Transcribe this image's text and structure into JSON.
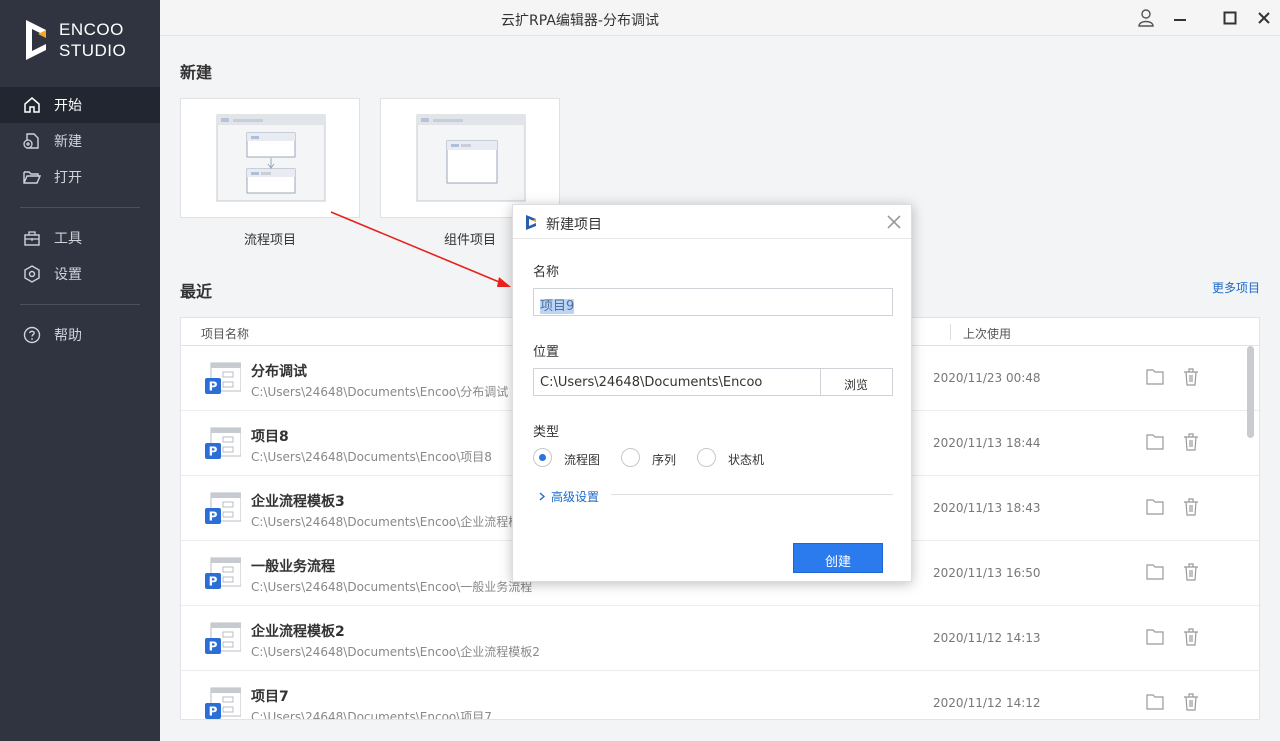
{
  "window": {
    "title": "云扩RPA编辑器-分布调试"
  },
  "brand": {
    "line1": "ENCOO",
    "line2": "STUDIO"
  },
  "colors": {
    "sidebar": "#2f3440",
    "accent": "#2b7bef",
    "link": "#1b6ac9",
    "arrow": "#e8211c"
  },
  "sidebar": {
    "items": [
      {
        "label": "开始",
        "icon": "home-icon",
        "active": true
      },
      {
        "label": "新建",
        "icon": "new-file-icon"
      },
      {
        "label": "打开",
        "icon": "folder-open-icon"
      },
      {
        "label": "工具",
        "icon": "toolbox-icon"
      },
      {
        "label": "设置",
        "icon": "gear-icon"
      },
      {
        "label": "帮助",
        "icon": "help-icon"
      }
    ]
  },
  "new_section": {
    "title": "新建",
    "cards": [
      {
        "label": "流程项目"
      },
      {
        "label": "组件项目"
      }
    ]
  },
  "recent": {
    "title": "最近",
    "more_label": "更多项目",
    "columns": {
      "name": "项目名称",
      "last_used": "上次使用"
    },
    "rows": [
      {
        "name": "分布调试",
        "path": "C:\\Users\\24648\\Documents\\Encoo\\分布调试",
        "date": "2020/11/23 00:48"
      },
      {
        "name": "项目8",
        "path": "C:\\Users\\24648\\Documents\\Encoo\\项目8",
        "date": "2020/11/13 18:44"
      },
      {
        "name": "企业流程模板3",
        "path": "C:\\Users\\24648\\Documents\\Encoo\\企业流程模",
        "date": "2020/11/13 18:43"
      },
      {
        "name": "一般业务流程",
        "path": "C:\\Users\\24648\\Documents\\Encoo\\一般业务流程",
        "date": "2020/11/13 16:50"
      },
      {
        "name": "企业流程模板2",
        "path": "C:\\Users\\24648\\Documents\\Encoo\\企业流程模板2",
        "date": "2020/11/12 14:13"
      },
      {
        "name": "项目7",
        "path": "C:\\Users\\24648\\Documents\\Encoo\\项目7",
        "date": "2020/11/12 14:12"
      }
    ]
  },
  "dialog": {
    "title": "新建项目",
    "name_label": "名称",
    "name_value": "项目9",
    "location_label": "位置",
    "location_value": "C:\\Users\\24648\\Documents\\Encoo",
    "browse_label": "浏览",
    "type_label": "类型",
    "types": [
      {
        "label": "流程图",
        "selected": true
      },
      {
        "label": "序列",
        "selected": false
      },
      {
        "label": "状态机",
        "selected": false
      }
    ],
    "advanced_label": "高级设置",
    "create_label": "创建"
  }
}
